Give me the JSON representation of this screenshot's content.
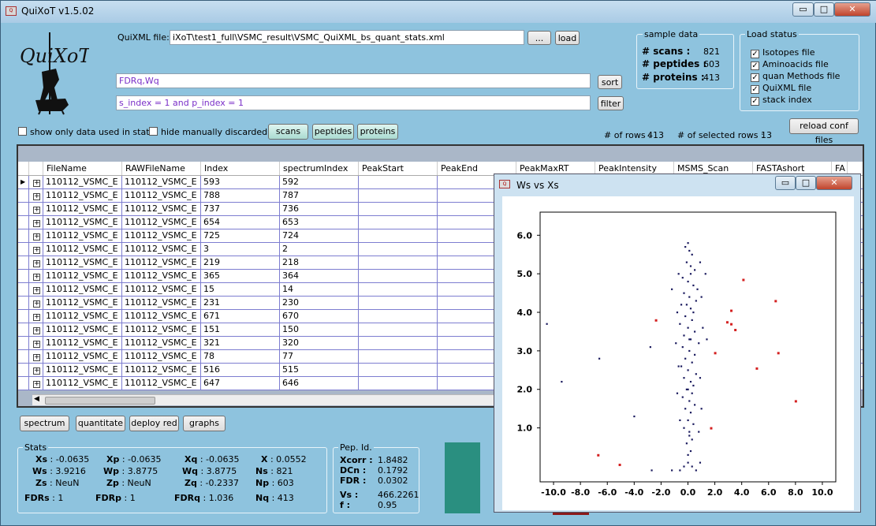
{
  "app": {
    "title": "QuiXoT v1.5.02"
  },
  "window_buttons": {
    "minimize": "▭",
    "maximize": "□",
    "close": "✕"
  },
  "logo": {
    "text": "QuiXoT"
  },
  "quixml": {
    "label": "QuiXML file:",
    "value": "iXoT\\test1_full\\VSMC_result\\VSMC_QuiXML_bs_quant_stats.xml",
    "browse": "...",
    "load": "load"
  },
  "sort": {
    "value": "FDRq,Wq",
    "button": "sort"
  },
  "filter": {
    "value": "s_index = 1 and p_index = 1",
    "button": "filter"
  },
  "sample": {
    "title": "sample data",
    "scans_label": "# scans :",
    "scans": "821",
    "peptides_label": "# peptides :",
    "peptides": "603",
    "proteins_label": "# proteins :",
    "proteins": "413"
  },
  "load_status": {
    "title": "Load status",
    "items": [
      "Isotopes file",
      "Aminoacids file",
      "quan Methods file",
      "QuiXML file",
      "stack index"
    ]
  },
  "options": {
    "show_only": "show only data used in stats",
    "hide_manual": "hide manually discarded"
  },
  "views": {
    "scans": "scans",
    "peptides": "peptides",
    "proteins": "proteins"
  },
  "counts": {
    "rows_label": "# of rows :",
    "rows": "413",
    "selected_label": "# of  selected rows :",
    "selected": "13"
  },
  "reload": "reload conf files",
  "table": {
    "columns": [
      "FileName",
      "RAWFileName",
      "Index",
      "spectrumIndex",
      "PeakStart",
      "PeakEnd",
      "PeakMaxRT",
      "PeakIntensity",
      "MSMS_Scan",
      "FASTAshort",
      "FA"
    ],
    "rows": [
      [
        "110112_VSMC_E",
        "110112_VSMC_E",
        "593",
        "592"
      ],
      [
        "110112_VSMC_E",
        "110112_VSMC_E",
        "788",
        "787"
      ],
      [
        "110112_VSMC_E",
        "110112_VSMC_E",
        "737",
        "736"
      ],
      [
        "110112_VSMC_E",
        "110112_VSMC_E",
        "654",
        "653"
      ],
      [
        "110112_VSMC_E",
        "110112_VSMC_E",
        "725",
        "724"
      ],
      [
        "110112_VSMC_E",
        "110112_VSMC_E",
        "3",
        "2"
      ],
      [
        "110112_VSMC_E",
        "110112_VSMC_E",
        "219",
        "218"
      ],
      [
        "110112_VSMC_E",
        "110112_VSMC_E",
        "365",
        "364"
      ],
      [
        "110112_VSMC_E",
        "110112_VSMC_E",
        "15",
        "14"
      ],
      [
        "110112_VSMC_E",
        "110112_VSMC_E",
        "231",
        "230"
      ],
      [
        "110112_VSMC_E",
        "110112_VSMC_E",
        "671",
        "670"
      ],
      [
        "110112_VSMC_E",
        "110112_VSMC_E",
        "151",
        "150"
      ],
      [
        "110112_VSMC_E",
        "110112_VSMC_E",
        "321",
        "320"
      ],
      [
        "110112_VSMC_E",
        "110112_VSMC_E",
        "78",
        "77"
      ],
      [
        "110112_VSMC_E",
        "110112_VSMC_E",
        "516",
        "515"
      ],
      [
        "110112_VSMC_E",
        "110112_VSMC_E",
        "647",
        "646"
      ]
    ]
  },
  "actions": {
    "spectrum": "spectrum",
    "quantitate": "quantitate",
    "deploy": "deploy red",
    "graphs": "graphs"
  },
  "stats": {
    "title": "Stats",
    "Xs": "Xs",
    "Xs_v": ": -0.0635",
    "Xp": "Xp",
    "Xp_v": ": -0.0635",
    "Xq": "Xq",
    "Xq_v": ": -0.0635",
    "X": "X",
    "X_v": ": 0.0552",
    "Ws": "Ws",
    "Ws_v": ": 3.9216",
    "Wp": "Wp",
    "Wp_v": ": 3.8775",
    "Wq": "Wq",
    "Wq_v": ": 3.8775",
    "Ns": "Ns",
    "Ns_v": ": 821",
    "Zs": "Zs",
    "Zs_v": ": NeuN",
    "Zp": "Zp",
    "Zp_v": ": NeuN",
    "Zq": "Zq",
    "Zq_v": ": -0.2337",
    "Np": "Np",
    "Np_v": ": 603",
    "FDRs": "FDRs",
    "FDRs_v": ": 1",
    "FDRp": "FDRp",
    "FDRp_v": ": 1",
    "FDRq": "FDRq",
    "FDRq_v": ": 1.036",
    "Nq": "Nq",
    "Nq_v": ": 413"
  },
  "pepid": {
    "title": "Pep. Id.",
    "xcorr_l": "Xcorr :",
    "xcorr": "1.8482",
    "dcn_l": "DCn :",
    "dcn": "0.1792",
    "fdr_l": "FDR :",
    "fdr": "0.0302",
    "vs_l": "Vs :",
    "vs": "466.2261",
    "f_l": "f :",
    "f": "0.95"
  },
  "plot": {
    "title": "Ws vs Xs"
  },
  "chart_data": {
    "type": "scatter",
    "title": "",
    "xlim": [
      -11,
      11
    ],
    "ylim": [
      -0.4,
      6.6
    ],
    "xticks": [
      "-10.0",
      "-8.0",
      "-6.0",
      "-4.0",
      "-2.0",
      "0.0",
      "2.0",
      "4.0",
      "6.0",
      "8.0",
      "10.0"
    ],
    "yticks": [
      "1.0",
      "2.0",
      "3.0",
      "4.0",
      "5.0",
      "6.0"
    ],
    "series": [
      {
        "color": "#1a1a5e",
        "points": [
          [
            -10.5,
            3.7
          ],
          [
            -9.4,
            2.2
          ],
          [
            -6.6,
            2.8
          ],
          [
            -4.0,
            1.3
          ],
          [
            -2.8,
            3.1
          ],
          [
            -2.7,
            -0.1
          ],
          [
            -1.2,
            -0.1
          ],
          [
            -0.6,
            -0.1
          ],
          [
            -0.3,
            0.0
          ],
          [
            0.0,
            0.1
          ],
          [
            0.3,
            0.0
          ],
          [
            0.6,
            -0.1
          ],
          [
            0.9,
            0.1
          ],
          [
            -0.2,
            5.7
          ],
          [
            0.1,
            5.6
          ],
          [
            0.3,
            5.5
          ],
          [
            -0.1,
            5.3
          ],
          [
            0.2,
            5.2
          ],
          [
            0.5,
            5.1
          ],
          [
            -0.4,
            4.9
          ],
          [
            0.0,
            4.8
          ],
          [
            0.4,
            4.7
          ],
          [
            0.7,
            4.6
          ],
          [
            -0.3,
            4.5
          ],
          [
            0.1,
            4.4
          ],
          [
            0.6,
            4.3
          ],
          [
            -0.5,
            4.2
          ],
          [
            0.2,
            4.1
          ],
          [
            0.4,
            4.0
          ],
          [
            -0.2,
            3.9
          ],
          [
            0.3,
            3.8
          ],
          [
            -0.6,
            3.7
          ],
          [
            0.0,
            3.6
          ],
          [
            0.5,
            3.5
          ],
          [
            -0.3,
            3.4
          ],
          [
            0.2,
            3.3
          ],
          [
            0.8,
            3.2
          ],
          [
            -0.4,
            3.1
          ],
          [
            0.1,
            3.0
          ],
          [
            0.5,
            2.9
          ],
          [
            -0.2,
            2.8
          ],
          [
            0.3,
            2.7
          ],
          [
            -0.5,
            2.6
          ],
          [
            0.0,
            2.5
          ],
          [
            0.6,
            2.4
          ],
          [
            -0.3,
            2.3
          ],
          [
            0.2,
            2.2
          ],
          [
            0.4,
            2.1
          ],
          [
            -0.1,
            2.0
          ],
          [
            0.3,
            1.9
          ],
          [
            -0.4,
            1.8
          ],
          [
            0.1,
            1.7
          ],
          [
            0.5,
            1.6
          ],
          [
            -0.2,
            1.5
          ],
          [
            0.2,
            1.4
          ],
          [
            0.0,
            1.2
          ],
          [
            0.4,
            1.1
          ],
          [
            -0.3,
            1.0
          ],
          [
            0.1,
            0.9
          ],
          [
            0.3,
            0.7
          ],
          [
            -0.1,
            0.6
          ],
          [
            0.2,
            0.4
          ],
          [
            0.0,
            0.3
          ],
          [
            -0.7,
            5.0
          ],
          [
            0.9,
            5.3
          ],
          [
            -0.8,
            4.0
          ],
          [
            1.0,
            4.4
          ],
          [
            -0.9,
            3.2
          ],
          [
            1.1,
            3.6
          ],
          [
            -0.7,
            2.6
          ],
          [
            0.9,
            2.3
          ],
          [
            -0.8,
            1.9
          ],
          [
            1.0,
            1.5
          ],
          [
            -0.6,
            1.2
          ],
          [
            0.8,
            0.9
          ],
          [
            1.4,
            3.3
          ],
          [
            1.3,
            5.0
          ],
          [
            -1.2,
            4.6
          ],
          [
            0.0,
            5.8
          ],
          [
            0.2,
            5.0
          ],
          [
            -0.1,
            4.2
          ],
          [
            0.1,
            3.3
          ],
          [
            0.0,
            2.0
          ],
          [
            0.1,
            0.8
          ]
        ]
      },
      {
        "color": "#d42020",
        "points": [
          [
            -6.7,
            0.3
          ],
          [
            -5.1,
            0.05
          ],
          [
            -2.4,
            3.8
          ],
          [
            1.7,
            1.0
          ],
          [
            2.0,
            2.95
          ],
          [
            2.9,
            3.75
          ],
          [
            3.2,
            4.05
          ],
          [
            3.2,
            3.7
          ],
          [
            3.5,
            3.55
          ],
          [
            4.1,
            4.85
          ],
          [
            5.1,
            2.55
          ],
          [
            6.5,
            4.3
          ],
          [
            6.7,
            2.95
          ],
          [
            8.0,
            1.7
          ]
        ]
      }
    ]
  }
}
